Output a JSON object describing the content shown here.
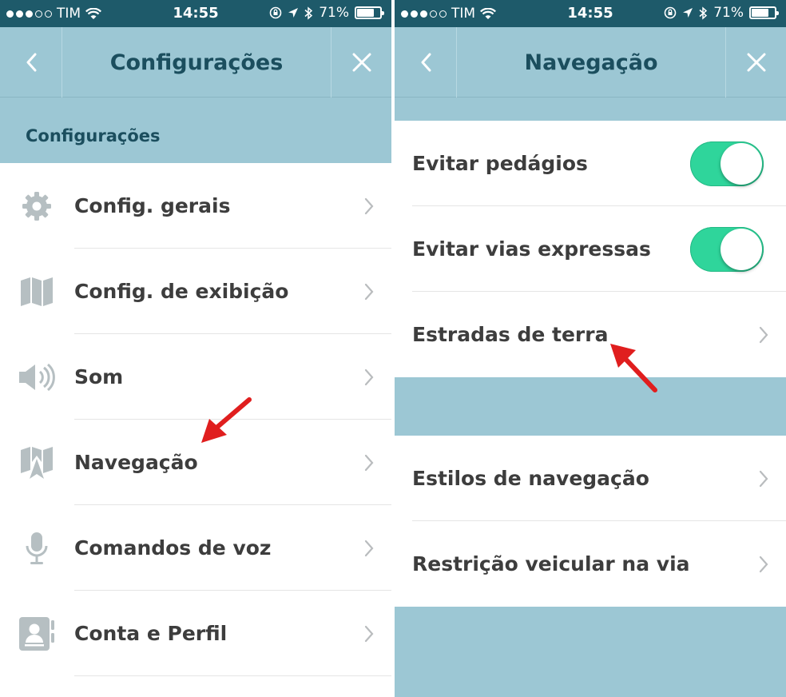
{
  "colors": {
    "statusbar_bg": "#1e5a6a",
    "navbar_bg": "#9cc7d4",
    "title_color": "#1b4e5e",
    "label_color": "#3d3d3d",
    "toggle_on": "#2fd59b",
    "annotation_arrow": "#e01e1e",
    "icon_gray": "#b6bfc2"
  },
  "status_bar": {
    "carrier": "TIM",
    "time": "14:55",
    "battery": "71%",
    "icons": [
      "signal-dots-icon",
      "wifi-icon",
      "lock-rotation-icon",
      "location-arrow-icon",
      "bluetooth-icon",
      "battery-icon"
    ]
  },
  "left_screen": {
    "nav": {
      "title": "Configurações",
      "back_icon": "chevron-left-icon",
      "close_icon": "close-icon"
    },
    "section_header": "Configurações",
    "items": [
      {
        "label": "Config. gerais",
        "icon": "gear-icon"
      },
      {
        "label": "Config. de exibição",
        "icon": "map-icon"
      },
      {
        "label": "Som",
        "icon": "speaker-icon"
      },
      {
        "label": "Navegação",
        "icon": "navigation-map-icon"
      },
      {
        "label": "Comandos de voz",
        "icon": "microphone-icon"
      },
      {
        "label": "Conta e Perfil",
        "icon": "profile-card-icon"
      }
    ]
  },
  "right_screen": {
    "nav": {
      "title": "Navegação",
      "back_icon": "chevron-left-icon",
      "close_icon": "close-icon"
    },
    "group1": [
      {
        "label": "Evitar pedágios",
        "toggle": true
      },
      {
        "label": "Evitar vias expressas",
        "toggle": true
      },
      {
        "label": "Estradas de terra",
        "chevron": true
      }
    ],
    "group2": [
      {
        "label": "Estilos de navegação",
        "chevron": true
      },
      {
        "label": "Restrição veicular na via",
        "chevron": true
      }
    ]
  }
}
